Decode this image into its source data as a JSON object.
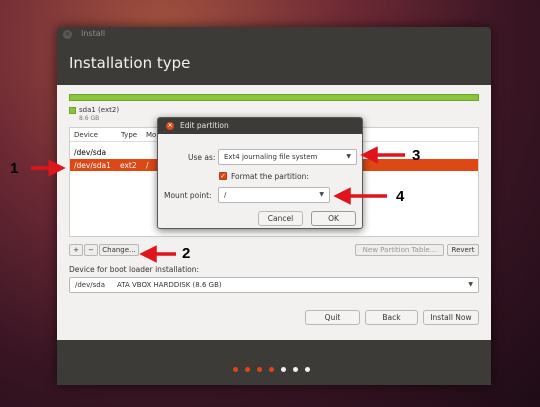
{
  "window": {
    "title": "Install",
    "heading": "Installation type"
  },
  "partition_bar": {
    "name": "sda1 (ext2)",
    "size": "8.6 GB"
  },
  "table": {
    "headers": [
      "Device",
      "Type",
      "Mo"
    ],
    "rows": [
      {
        "device": "/dev/sda",
        "type": "",
        "mount": ""
      },
      {
        "device": "/dev/sda1",
        "type": "ext2",
        "mount": "/"
      }
    ]
  },
  "partition_buttons": {
    "add": "+",
    "remove": "−",
    "change": "Change...",
    "new_table": "New Partition Table...",
    "revert": "Revert"
  },
  "boot_loader": {
    "label": "Device for boot loader installation:",
    "device": "/dev/sda",
    "description": "ATA VBOX HARDDISK (8.6 GB)"
  },
  "nav_buttons": {
    "quit": "Quit",
    "back": "Back",
    "install": "Install Now"
  },
  "progress": {
    "total_steps": 7,
    "completed_steps": 4
  },
  "dialog": {
    "title": "Edit partition",
    "use_as_label": "Use as:",
    "use_as_value": "Ext4 journaling file system",
    "format_label": "Format the partition:",
    "format_checked": true,
    "mount_label": "Mount point:",
    "mount_value": "/",
    "cancel": "Cancel",
    "ok": "OK"
  },
  "annotations": [
    "1",
    "2",
    "3",
    "4"
  ],
  "colors": {
    "accent": "#dd4814",
    "window_dark": "#3c3b37",
    "partition_green": "#8ac43c",
    "arrow": "#e0141b"
  }
}
